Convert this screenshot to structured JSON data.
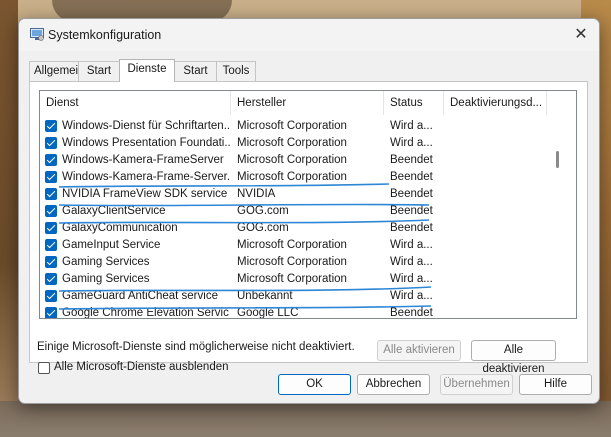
{
  "window": {
    "title": "Systemkonfiguration"
  },
  "tabs": [
    {
      "label": "Allgemein",
      "active": false
    },
    {
      "label": "Start",
      "active": false
    },
    {
      "label": "Dienste",
      "active": true
    },
    {
      "label": "Start",
      "active": false
    },
    {
      "label": "Tools",
      "active": false
    }
  ],
  "columns": [
    "Dienst",
    "Hersteller",
    "Status",
    "Deaktivierungsd..."
  ],
  "services": [
    {
      "name": "Windows-Dienst für Schriftarten...",
      "vendor": "Microsoft Corporation",
      "status": "Wird a...",
      "checked": true
    },
    {
      "name": "Windows Presentation Foundati...",
      "vendor": "Microsoft Corporation",
      "status": "Wird a...",
      "checked": true
    },
    {
      "name": "Windows-Kamera-FrameServer",
      "vendor": "Microsoft Corporation",
      "status": "Beendet",
      "checked": true
    },
    {
      "name": "Windows-Kamera-Frame-Server...",
      "vendor": "Microsoft Corporation",
      "status": "Beendet",
      "checked": true
    },
    {
      "name": "NVIDIA FrameView SDK service",
      "vendor": "NVIDIA",
      "status": "Beendet",
      "checked": true
    },
    {
      "name": "GalaxyClientService",
      "vendor": "GOG.com",
      "status": "Beendet",
      "checked": true
    },
    {
      "name": "GalaxyCommunication",
      "vendor": "GOG.com",
      "status": "Beendet",
      "checked": true
    },
    {
      "name": "GameInput Service",
      "vendor": "Microsoft Corporation",
      "status": "Wird a...",
      "checked": true
    },
    {
      "name": "Gaming Services",
      "vendor": "Microsoft Corporation",
      "status": "Wird a...",
      "checked": true
    },
    {
      "name": "Gaming Services",
      "vendor": "Microsoft Corporation",
      "status": "Wird a...",
      "checked": true
    },
    {
      "name": "GameGuard AntiCheat service",
      "vendor": "Unbekannt",
      "status": "Wird a...",
      "checked": true
    },
    {
      "name": "Google Chrome Elevation Servic...",
      "vendor": "Google LLC",
      "status": "Beendet",
      "checked": true
    }
  ],
  "note": "Einige Microsoft-Dienste sind möglicherweise nicht deaktiviert.",
  "enable_all": "Alle aktivieren",
  "disable_all": "Alle deaktivieren",
  "hide_ms_label": "Alle Microsoft-Dienste ausblenden",
  "hide_ms_checked": false,
  "footer": {
    "ok": "OK",
    "cancel": "Abbrechen",
    "apply": "Übernehmen",
    "help": "Hilfe"
  },
  "colors": {
    "accent": "#0067c0",
    "scribble": "#2e86d6"
  }
}
